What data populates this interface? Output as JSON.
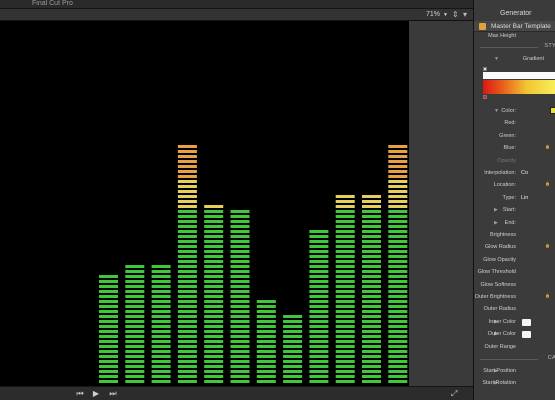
{
  "app": {
    "title": "Final Cut Pro"
  },
  "viewer": {
    "zoom": "71%",
    "meter": {
      "bars_percent_height": [
        31,
        35,
        34,
        69,
        52,
        50,
        25,
        20,
        45,
        55,
        55,
        69
      ],
      "colors": {
        "green": "#3ec83a",
        "yellow": "#e6d05a",
        "orange": "#e8a040",
        "red": "#e0261c",
        "background": "#000000"
      }
    }
  },
  "transport": {
    "prev_icon": "skip-back-icon",
    "play_icon": "play-icon",
    "next_icon": "skip-forward-icon",
    "fullscreen_icon": "fullscreen-icon"
  },
  "inspector": {
    "tab": "Generator",
    "header_title": "Master Bar Template",
    "hidden_row": "Max Height",
    "section_style": "STY",
    "gradient_label": "Gradient",
    "rows": [
      {
        "label": "Color:",
        "value": ""
      },
      {
        "label": "Red:",
        "value": ""
      },
      {
        "label": "Green:",
        "value": ""
      },
      {
        "label": "Blue:",
        "value": ""
      },
      {
        "label": "Opacity",
        "value": ""
      },
      {
        "label": "Interpolation:",
        "value": "Co"
      },
      {
        "label": "Location:",
        "value": ""
      },
      {
        "label": "Type:",
        "value": "Lin"
      },
      {
        "label": "Start:",
        "value": ""
      },
      {
        "label": "End:",
        "value": ""
      },
      {
        "label": "Brightness",
        "value": ""
      },
      {
        "label": "Glow Radius",
        "value": ""
      },
      {
        "label": "Glow Opacity",
        "value": ""
      },
      {
        "label": "Glow Threshold",
        "value": ""
      },
      {
        "label": "Glow Softness",
        "value": ""
      },
      {
        "label": "Outer Brightness",
        "value": ""
      },
      {
        "label": "Outer Radius",
        "value": ""
      },
      {
        "label": "Inner Color",
        "value": ""
      },
      {
        "label": "Outer Color",
        "value": ""
      },
      {
        "label": "Outer Range",
        "value": ""
      }
    ],
    "section_ca": "CA",
    "bottom_rows": [
      {
        "label": "Start Position"
      },
      {
        "label": "Start Rotation"
      }
    ]
  }
}
